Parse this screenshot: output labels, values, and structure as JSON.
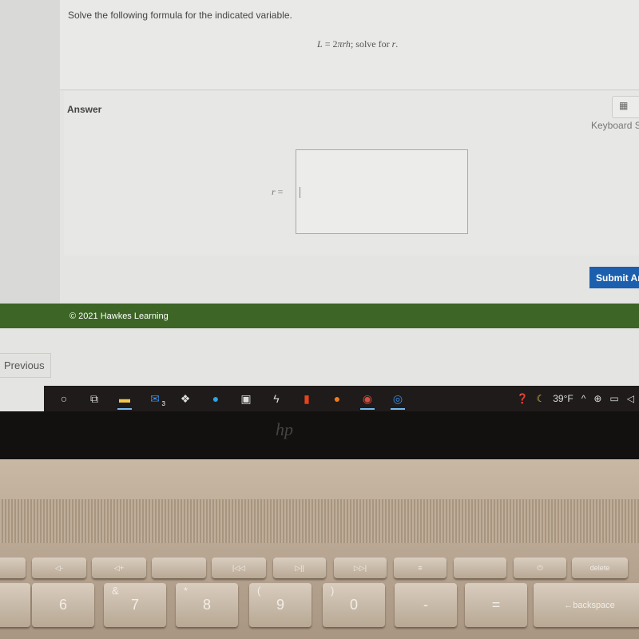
{
  "question": {
    "instruction": "Solve the following formula for the indicated variable.",
    "formula_lhs": "L",
    "formula_eq": " = 2",
    "formula_vars": "πrh",
    "formula_tail": "; solve for ",
    "formula_target": "r",
    "formula_end": "."
  },
  "answer": {
    "label": "Answer",
    "keyboard_button": "▦",
    "keyboard_label": "Keyboard S",
    "variable": "r",
    "equals": " =",
    "value": ""
  },
  "actions": {
    "submit": "Submit An",
    "previous": "Previous"
  },
  "footer": {
    "copyright": "© 2021 Hawkes Learning"
  },
  "taskbar": {
    "icons": [
      "search-icon",
      "task-view-icon",
      "file-explorer-icon",
      "mail-icon",
      "dropbox-icon",
      "edge-icon",
      "store-icon",
      "bolt-icon",
      "office-icon",
      "firefox-icon",
      "chrome-icon",
      "app-icon"
    ],
    "mail_badge": "3",
    "weather": "39°F",
    "up_arrow": "^"
  },
  "laptop": {
    "logo": "hp",
    "keys": {
      "six": "6",
      "seven": "7",
      "eight": "8",
      "nine": "9",
      "zero": "0",
      "amp": "&",
      "star": "*",
      "lparen": "(",
      "rparen": ")",
      "backspace": "backspace",
      "delete": "delete"
    }
  },
  "colors": {
    "footer": "#3c6526",
    "submit": "#1b5fae"
  }
}
